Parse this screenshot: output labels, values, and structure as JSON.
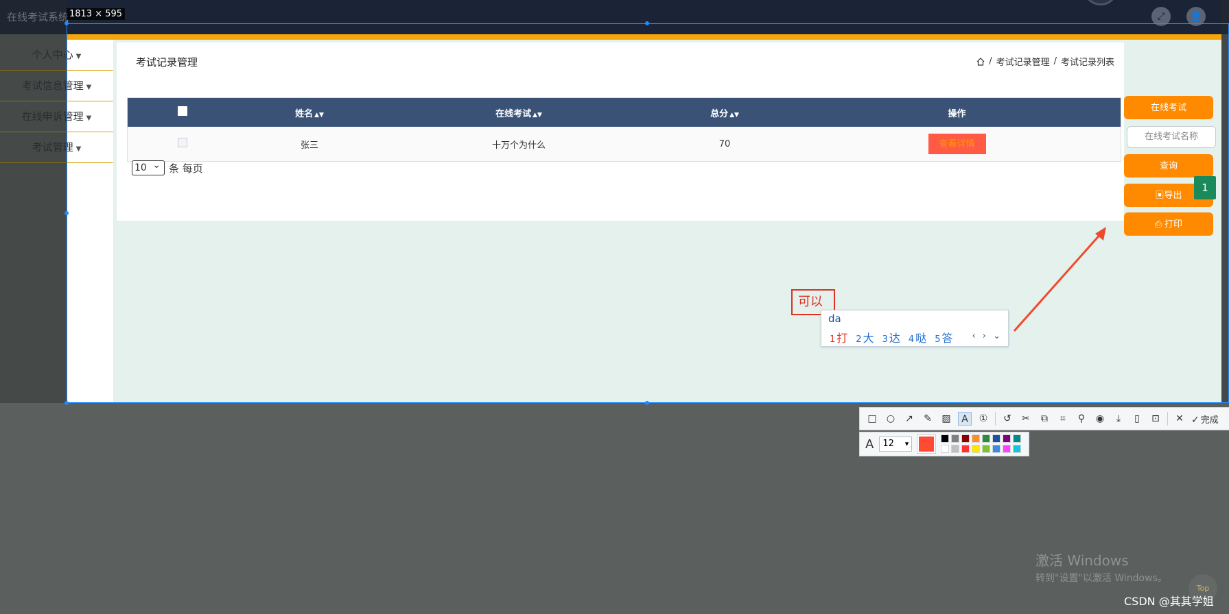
{
  "app": {
    "title": "在线考试系统"
  },
  "header": {
    "fullscreen_icon": "expand-icon",
    "user_icon": "user-icon"
  },
  "sidebar": {
    "items": [
      {
        "label": "个人中心"
      },
      {
        "label": "考试信息管理"
      },
      {
        "label": "在线申诉管理"
      },
      {
        "label": "考试管理"
      }
    ]
  },
  "page": {
    "title": "考试记录管理",
    "breadcrumb": [
      "考试记录管理",
      "考试记录列表"
    ]
  },
  "table": {
    "headers": [
      "姓名",
      "在线考试",
      "总分",
      "操作"
    ],
    "rows": [
      {
        "name": "张三",
        "exam": "十万个为什么",
        "score": "70",
        "action": "查看详情"
      }
    ]
  },
  "pager": {
    "page_size": "10",
    "suffix": "条 每页"
  },
  "actions": {
    "online_exam": "在线考试",
    "search_placeholder": "在线考试名称",
    "query": "查询",
    "export": "导出",
    "print": "打印",
    "badge": "1"
  },
  "screenshot_tool": {
    "size_label": "1813 × 595",
    "text_annotation": "可以",
    "ime_input": "da",
    "ime_candidates": [
      {
        "num": "1",
        "char": "打"
      },
      {
        "num": "2",
        "char": "大"
      },
      {
        "num": "3",
        "char": "达"
      },
      {
        "num": "4",
        "char": "哒"
      },
      {
        "num": "5",
        "char": "答"
      }
    ],
    "done_label": "完成",
    "font_size": "12",
    "current_color": "#ff4b33",
    "palette": [
      "#000000",
      "#808080",
      "#8b0000",
      "#ff8c2a",
      "#2e8b3a",
      "#1f4fa0",
      "#800080",
      "#008b8b",
      "#ffffff",
      "#c0c0c0",
      "#ff3030",
      "#ffe600",
      "#7cc42a",
      "#3a8ae6",
      "#ff40ff",
      "#12c8d8"
    ]
  },
  "watermark": {
    "line1": "激活 Windows",
    "line2": "转到\"设置\"以激活 Windows。",
    "csdn": "CSDN @其其学姐",
    "top": "Top"
  }
}
